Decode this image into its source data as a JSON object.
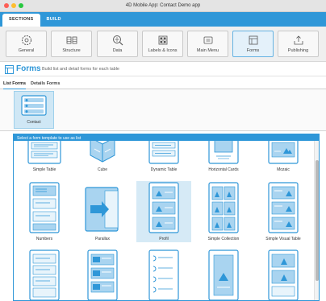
{
  "window": {
    "title": "4D Mobile App: Contact Demo app"
  },
  "traffic_lights": {
    "close_color": "#fd5f57",
    "minimize_color": "#febd2e",
    "zoom_color": "#28c840"
  },
  "tabs": [
    {
      "label": "SECTIONS",
      "active": true
    },
    {
      "label": "BUILD",
      "active": false
    }
  ],
  "toolbar": {
    "items": [
      {
        "label": "General",
        "icon": "gear-icon"
      },
      {
        "label": "Structure",
        "icon": "table-icon"
      },
      {
        "label": "Data",
        "icon": "database-search-icon"
      },
      {
        "label": "Labels & Icons",
        "icon": "icon-grid-icon"
      },
      {
        "label": "Main Menu",
        "icon": "menu-icon"
      },
      {
        "label": "Forms",
        "icon": "forms-icon",
        "selected": true
      },
      {
        "label": "Publishing",
        "icon": "upload-icon"
      }
    ]
  },
  "section": {
    "title": "Forms",
    "subtitle": "Build list and detail forms for each table"
  },
  "form_tabs": [
    {
      "label": "List Forms",
      "active": true
    },
    {
      "label": "Details Forms",
      "active": false
    }
  ],
  "tables": [
    {
      "label": "Contact",
      "selected": true
    }
  ],
  "template_picker": {
    "banner": "Select a form template to use as list",
    "row1": [
      "Simple Table",
      "Cube",
      "Dynamic Table",
      "Horizontal Cards",
      "Mozaic"
    ],
    "row2": [
      "Numbers",
      "Parallax",
      "Profil",
      "Simple Collection",
      "Simple Visual Table"
    ],
    "selected": "Profil"
  },
  "colors": {
    "accent": "#2f97d8",
    "selection": "#d6eaf6",
    "icon_light": "#a9d4f0"
  }
}
